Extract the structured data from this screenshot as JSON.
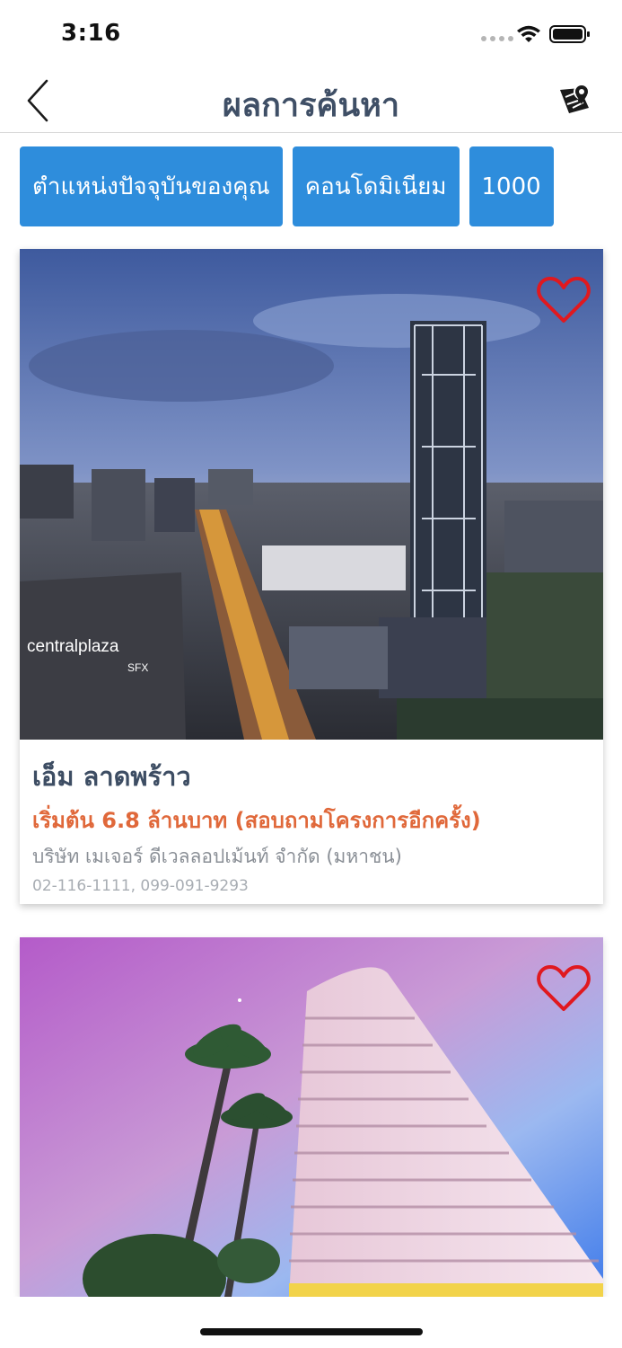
{
  "status_bar": {
    "time": "3:16"
  },
  "nav": {
    "title": "ผลการค้นหา",
    "back_icon": "chevron-left-icon",
    "map_icon": "map-pin-icon"
  },
  "filters": [
    {
      "label": "ตำแหน่งปัจจุบันของคุณ"
    },
    {
      "label": "คอนโดมิเนียม"
    },
    {
      "label": "1000"
    }
  ],
  "listings": [
    {
      "name": "เอ็ม ลาดพร้าว",
      "price": "เริ่มต้น 6.8 ล้านบาท (สอบถามโครงการอีกครั้ง)",
      "developer": "บริษัท เมเจอร์ ดีเวลลอปเม้นท์ จำกัด (มหาชน)",
      "phones": "02-116-1111, 099-091-9293",
      "image_sign": "centralplaza",
      "image_sub_sign": "SFX",
      "favorite_icon": "heart-outline-icon"
    },
    {
      "favorite_icon": "heart-outline-icon"
    }
  ],
  "colors": {
    "accent": "#2e8ddc",
    "title": "#3f4f66",
    "price": "#e0683a",
    "heart": "#e0191f"
  }
}
